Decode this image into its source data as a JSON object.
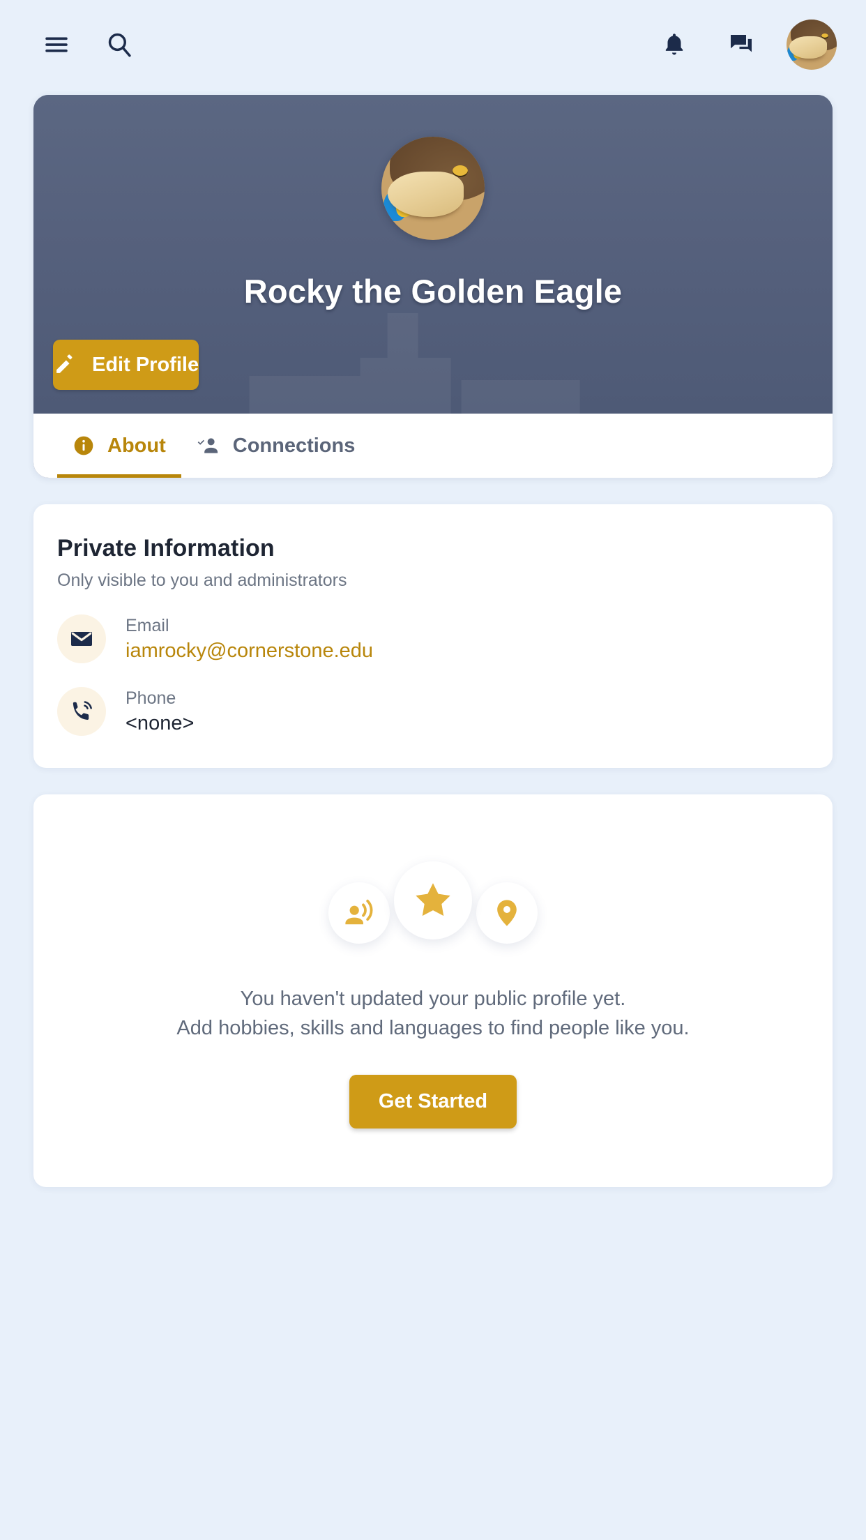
{
  "colors": {
    "page_background": "#e8f0fa",
    "header_cover": "#55617f",
    "accent_gold": "#cf9b17",
    "tab_active": "#b8860b",
    "icon_navy": "#1c2b4a",
    "illustration_gold": "#e4b23c"
  },
  "appbar": {
    "menu_icon": "hamburger-menu-icon",
    "search_icon": "search-icon",
    "notifications_icon": "bell-icon",
    "messages_icon": "forum-icon",
    "avatar_icon": "user-avatar"
  },
  "profile": {
    "name": "Rocky the Golden Eagle",
    "avatar_alt": "Rocky the Golden Eagle mascot",
    "edit_button_label": "Edit Profile",
    "edit_button_icon": "pencil-icon"
  },
  "tabs": [
    {
      "label": "About",
      "icon": "info-icon",
      "active": true
    },
    {
      "label": "Connections",
      "icon": "person-check-icon",
      "active": false
    }
  ],
  "private_information": {
    "title": "Private Information",
    "subtitle": "Only visible to you and administrators",
    "rows": [
      {
        "icon": "email-icon",
        "label": "Email",
        "value": "iamrocky@cornerstone.edu",
        "is_link": true
      },
      {
        "icon": "phone-icon",
        "label": "Phone",
        "value": "<none>",
        "is_link": false
      }
    ]
  },
  "public_profile_empty": {
    "illustration_icons": [
      "record-voice-over-icon",
      "star-icon",
      "location-pin-icon"
    ],
    "line1": "You haven't updated your public profile yet.",
    "line2": "Add hobbies, skills and languages to find people like you.",
    "button_label": "Get Started"
  }
}
